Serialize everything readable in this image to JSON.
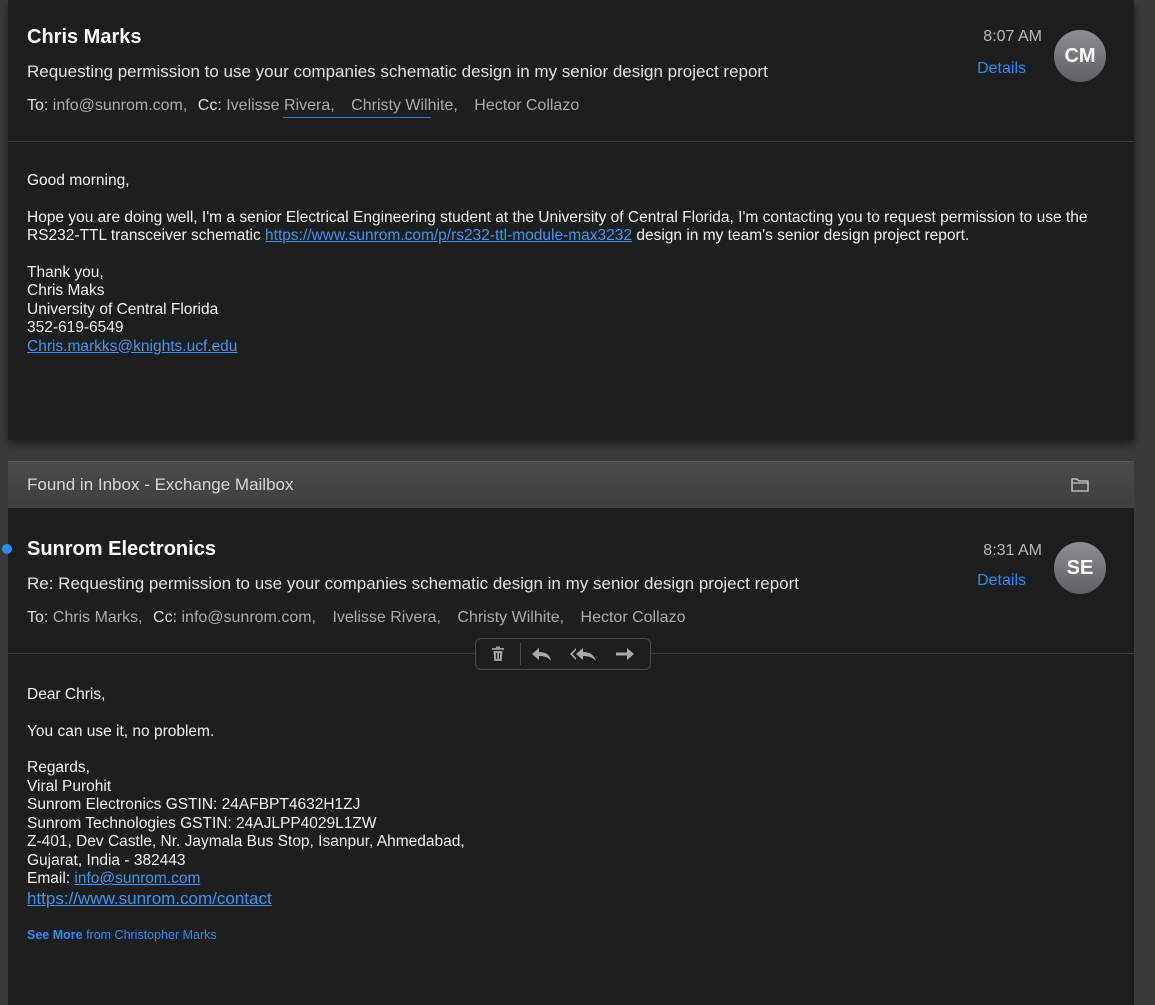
{
  "message1": {
    "sender": "Chris Marks",
    "subject": "Requesting permission to use your companies schematic design in my senior design project report",
    "time": "8:07 AM",
    "details_label": "Details",
    "avatar": "CM",
    "to_label": "To:",
    "to": "info@sunrom.com,",
    "cc_label": "Cc:",
    "cc": [
      "Ivelisse Rivera,",
      "Christy Wilhite,",
      "Hector Collazo"
    ],
    "greeting": "Good morning,",
    "para_before_link": "Hope you are doing well, I'm a senior Electrical Engineering student at the University of Central Florida, I'm  contacting you to request permission to use the RS232-TTL transceiver schematic ",
    "link": "https://www.sunrom.com/p/rs232-ttl-module-max3232",
    "para_after_link": " design in my team's senior design project report.",
    "signature": [
      "Thank you,",
      "Chris Maks",
      "University of Central Florida",
      "352-619-6549"
    ],
    "email": "Chris.markks@knights.ucf.edu"
  },
  "banner": {
    "text": "Found in Inbox - Exchange Mailbox",
    "icon": "folder-icon"
  },
  "message2": {
    "sender": "Sunrom Electronics",
    "subject": "Re: Requesting permission to use your companies schematic design in my senior design project report",
    "time": "8:31 AM",
    "details_label": "Details",
    "avatar": "SE",
    "to_label": "To:",
    "to": "Chris Marks,",
    "cc_label": "Cc:",
    "cc": [
      "info@sunrom.com,",
      "Ivelisse Rivera,",
      "Christy Wilhite,",
      "Hector Collazo"
    ],
    "greeting": "Dear Chris,",
    "line": "You can use it, no problem.",
    "signature": [
      "Regards,",
      "Viral Purohit",
      "Sunrom Electronics GSTIN: 24AFBPT4632H1ZJ",
      "Sunrom Technologies GSTIN: 24AJLPP4029L1ZW",
      "Z-401, Dev Castle, Nr. Jaymala Bus Stop, Isanpur, Ahmedabad,",
      "Gujarat, India - 382443"
    ],
    "email_label": "Email: ",
    "email": "info@sunrom.com",
    "contact_link": "https://www.sunrom.com/contact",
    "see_more": "See More",
    "see_more_from": " from Christopher Marks",
    "toolbar": [
      "trash-icon",
      "reply-icon",
      "reply-all-icon",
      "forward-icon"
    ]
  },
  "colors": {
    "background": "#1d1e20",
    "link": "#3b95ee",
    "accent": "#2a8cf0"
  }
}
